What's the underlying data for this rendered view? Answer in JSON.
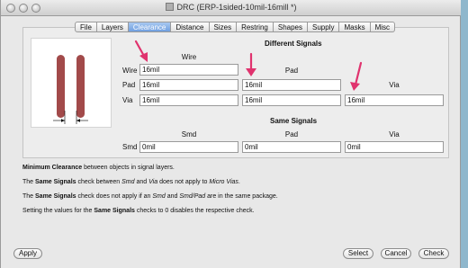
{
  "window": {
    "title": "DRC (ERP-1sided-10mil-16mill *)"
  },
  "tabs": [
    {
      "label": "File"
    },
    {
      "label": "Layers"
    },
    {
      "label": "Clearance",
      "active": true
    },
    {
      "label": "Distance"
    },
    {
      "label": "Sizes"
    },
    {
      "label": "Restring"
    },
    {
      "label": "Shapes"
    },
    {
      "label": "Supply"
    },
    {
      "label": "Masks"
    },
    {
      "label": "Misc"
    }
  ],
  "different": {
    "header": "Different Signals",
    "col_wire": "Wire",
    "col_pad": "Pad",
    "col_via": "Via",
    "row_wire": "Wire",
    "row_pad": "Pad",
    "row_via": "Via",
    "wire_wire": "16mil",
    "pad_wire": "16mil",
    "pad_pad": "16mil",
    "via_wire": "16mil",
    "via_pad": "16mil",
    "via_via": "16mil"
  },
  "same": {
    "header": "Same Signals",
    "col_smd": "Smd",
    "col_pad": "Pad",
    "col_via": "Via",
    "row_smd": "Smd",
    "smd_smd": "0mil",
    "smd_pad": "0mil",
    "smd_via": "0mil"
  },
  "info": {
    "line1": {
      "b": "Minimum Clearance",
      "t": " between objects in signal layers."
    },
    "line2": {
      "a": "The ",
      "b": "Same Signals",
      "c": " check between ",
      "i1": "Smd",
      "d": " and ",
      "i2": "Via",
      "e": " does not apply to ",
      "i3": "Micro Vias",
      "f": "."
    },
    "line3": {
      "a": "The ",
      "b": "Same Signals",
      "c": " check does not apply if an ",
      "i1": "Smd",
      "d": " and ",
      "i2": "Smd/Pad",
      "e": " are in the same package."
    },
    "line4": {
      "a": "Setting the values for the ",
      "b": "Same Signals",
      "c": " checks to 0 disables the respective check."
    }
  },
  "buttons": {
    "apply": "Apply",
    "select": "Select",
    "cancel": "Cancel",
    "check": "Check"
  },
  "colors": {
    "arrow": "#e0336e",
    "trace": "#a24a4a",
    "tab_active": "#6f9fe0"
  },
  "icons": {
    "annotation_arrows": "down-arrow-icon",
    "traffic_lights": "window-control-icon"
  }
}
